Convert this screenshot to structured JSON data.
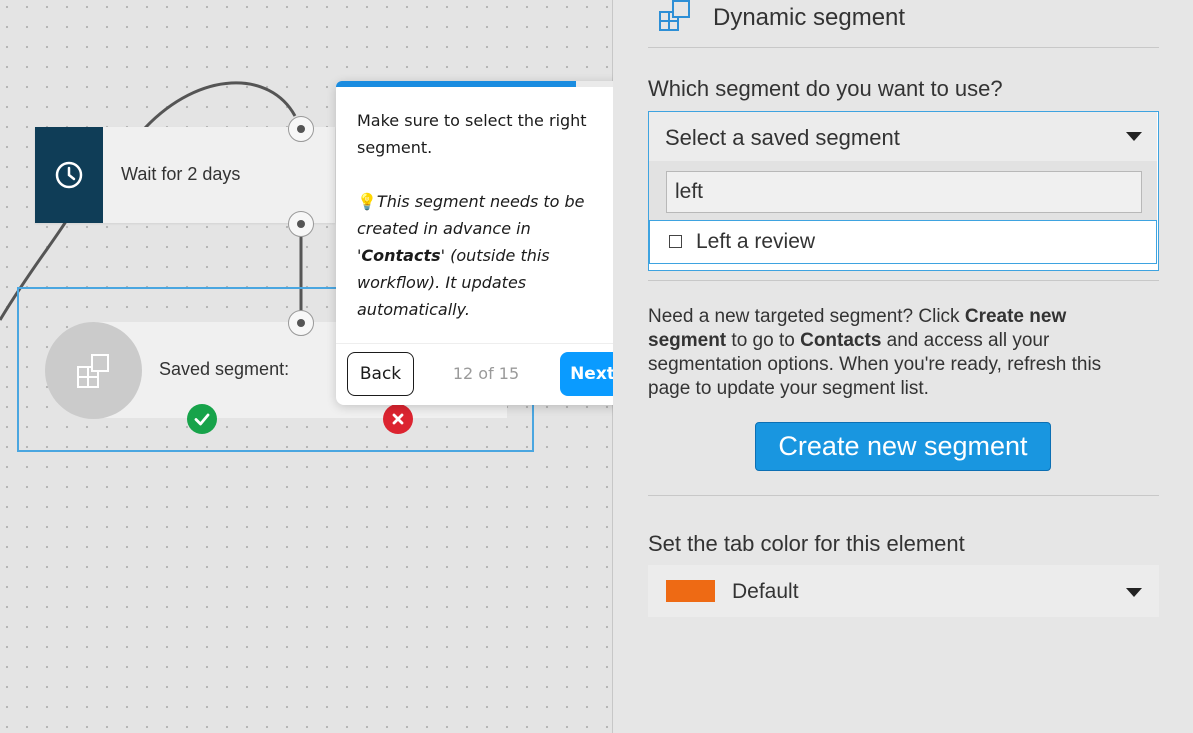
{
  "canvas": {
    "wait_node_label": "Wait for 2 days",
    "segment_node_label": "Saved segment:",
    "clock_icon": "clock-icon",
    "segment_icon": "segment-icon",
    "yes_icon": "check-icon",
    "no_icon": "x-icon"
  },
  "tooltip": {
    "text": "Make sure to select the right segment.",
    "hint_emoji": "💡",
    "hint_before": "This segment needs to be created in advance in '",
    "hint_bold": "Contacts",
    "hint_after": "' (outside this workflow). It updates automatically.",
    "back_label": "Back",
    "next_label": "Next",
    "step_text": "12 of 15",
    "progress_fraction": 0.8
  },
  "panel": {
    "title": "Dynamic segment",
    "question": "Which segment do you want to use?",
    "dropdown": {
      "selected": "Select a saved segment",
      "search_value": "left",
      "option_label": "Left a review"
    },
    "info": {
      "part1": "Need a new targeted segment? Click ",
      "bold1": "Create new segment",
      "part2": " to go to ",
      "bold2": "Contacts",
      "part3": " and access all your segmentation options. When you're ready, refresh this page to update your segment list."
    },
    "create_button": "Create new segment",
    "tab_color_label": "Set the tab color for this element",
    "tab_color_value": "Default",
    "tab_color_hex": "#ee6a14"
  },
  "colors": {
    "accent": "#1996e0",
    "node_dark": "#0f3d57",
    "yes": "#17a34a",
    "no": "#dc2430"
  }
}
